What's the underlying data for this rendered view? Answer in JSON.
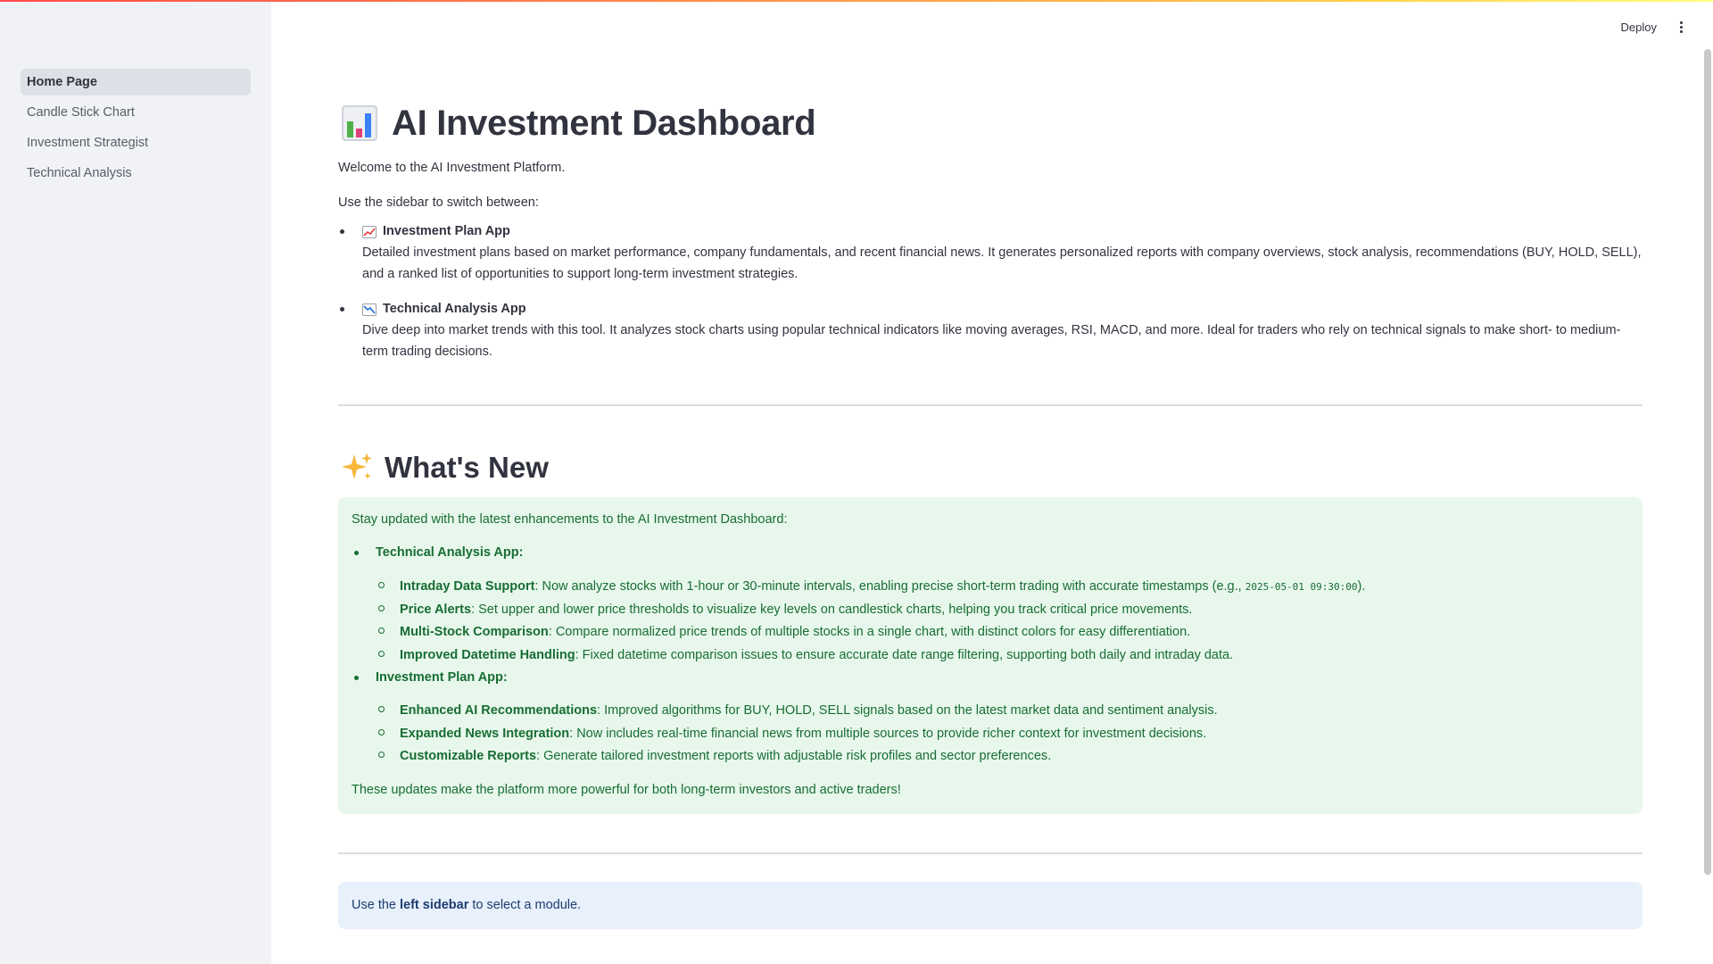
{
  "header": {
    "deploy_label": "Deploy",
    "menu_icon": "kebab-menu-icon"
  },
  "sidebar": {
    "items": [
      {
        "label": "Home Page",
        "active": true
      },
      {
        "label": "Candle Stick Chart",
        "active": false
      },
      {
        "label": "Investment Strategist",
        "active": false
      },
      {
        "label": "Technical Analysis",
        "active": false
      }
    ]
  },
  "main": {
    "title": "AI Investment Dashboard",
    "title_icon": "bar-chart-icon",
    "welcome": "Welcome to the AI Investment Platform.",
    "use_sidebar": "Use the sidebar to switch between:",
    "apps": [
      {
        "icon": "chart-increasing-icon",
        "title": "Investment Plan App",
        "desc": "Detailed investment plans based on market performance, company fundamentals, and recent financial news. It generates personalized reports with company overviews, stock analysis, recommendations (BUY, HOLD, SELL), and a ranked list of opportunities to support long-term investment strategies."
      },
      {
        "icon": "chart-decreasing-icon",
        "title": "Technical Analysis App",
        "desc": "Dive deep into market trends with this tool. It analyzes stock charts using popular technical indicators like moving averages, RSI, MACD, and more. Ideal for traders who rely on technical signals to make short- to medium-term trading decisions."
      }
    ],
    "whats_new_title": "What's New",
    "whats_new_icon": "sparkles-icon",
    "whats_new": {
      "intro": "Stay updated with the latest enhancements to the AI Investment Dashboard:",
      "sections": [
        {
          "title": "Technical Analysis App",
          "items": [
            {
              "bold": "Intraday Data Support",
              "text": ": Now analyze stocks with 1-hour or 30-minute intervals, enabling precise short-term trading with accurate timestamps (e.g., ",
              "code": "2025-05-01 09:30:00",
              "tail": ")."
            },
            {
              "bold": "Price Alerts",
              "text": ": Set upper and lower price thresholds to visualize key levels on candlestick charts, helping you track critical price movements."
            },
            {
              "bold": "Multi-Stock Comparison",
              "text": ": Compare normalized price trends of multiple stocks in a single chart, with distinct colors for easy differentiation."
            },
            {
              "bold": "Improved Datetime Handling",
              "text": ": Fixed datetime comparison issues to ensure accurate date range filtering, supporting both daily and intraday data."
            }
          ]
        },
        {
          "title": "Investment Plan App",
          "items": [
            {
              "bold": "Enhanced AI Recommendations",
              "text": ": Improved algorithms for BUY, HOLD, SELL signals based on the latest market data and sentiment analysis."
            },
            {
              "bold": "Expanded News Integration",
              "text": ": Now includes real-time financial news from multiple sources to provide richer context for investment decisions."
            },
            {
              "bold": "Customizable Reports",
              "text": ": Generate tailored investment reports with adjustable risk profiles and sector preferences."
            }
          ]
        }
      ],
      "outro": "These updates make the platform more powerful for both long-term investors and active traders!"
    },
    "info": {
      "pre": "Use the ",
      "bold": "left sidebar",
      "post": " to select a module."
    }
  },
  "colors": {
    "sidebar_bg": "#f0f2f6",
    "success_bg": "#e8f7ec",
    "success_text": "#176d33",
    "info_bg": "#e7f0fb",
    "info_text": "#1e3c6e"
  }
}
